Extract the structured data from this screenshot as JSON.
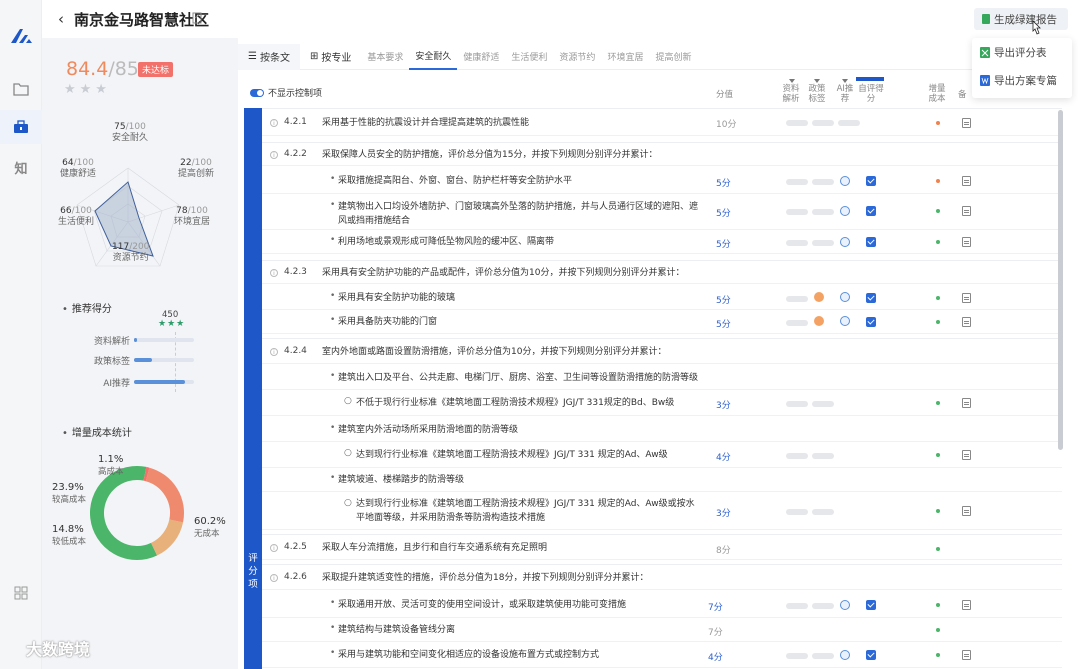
{
  "rail": {
    "knowledge_glyph": "知"
  },
  "header": {
    "title": "南京金马路智慧社区",
    "report_button": "生成绿建报告"
  },
  "dropdown": {
    "items": [
      "导出评分表",
      "导出方案专篇"
    ]
  },
  "summary": {
    "score": "84.4",
    "score_total": "/85",
    "status": "未达标",
    "stars": "★★★",
    "recommend_title": "推荐得分",
    "cost_title": "增量成本统计"
  },
  "radar": [
    {
      "name": "安全耐久",
      "score": "75",
      "max": "/100"
    },
    {
      "name": "提高创新",
      "score": "22",
      "max": "/100"
    },
    {
      "name": "环境宜居",
      "score": "78",
      "max": "/100"
    },
    {
      "name": "资源节约",
      "score": "117",
      "max": "/200"
    },
    {
      "name": "生活便利",
      "score": "66",
      "max": "/100"
    },
    {
      "name": "健康舒适",
      "score": "64",
      "max": "/100"
    }
  ],
  "recommend": {
    "value": "450",
    "stars": "★★★",
    "rows": [
      {
        "label": "资料解析",
        "fraction": 0.05
      },
      {
        "label": "政策标签",
        "fraction": 0.3
      },
      {
        "label": "AI推荐",
        "fraction": 0.85
      }
    ]
  },
  "cost": [
    {
      "name": "高成本",
      "pct": "1.1%",
      "value": 1.1,
      "color": "#f2726b"
    },
    {
      "name": "较高成本",
      "pct": "23.9%",
      "value": 23.9,
      "color": "#f08a6e"
    },
    {
      "name": "较低成本",
      "pct": "14.8%",
      "value": 14.8,
      "color": "#e8b07a"
    },
    {
      "name": "无成本",
      "pct": "60.2%",
      "value": 60.2,
      "color": "#4bb569"
    }
  ],
  "tabs": {
    "view": [
      "按条文",
      "按专业"
    ],
    "cat": [
      "基本要求",
      "安全耐久",
      "健康舒适",
      "生活便利",
      "资源节约",
      "环境宜居",
      "提高创新"
    ]
  },
  "table": {
    "toggle_label": "不显示控制项",
    "cols": [
      "分值",
      "资料解析",
      "政策标签",
      "AI推荐",
      "自评得分",
      "增量成本",
      "备"
    ],
    "band_label": "评分项"
  },
  "rows": [
    {
      "no": "4.2.1",
      "text": "采用基于性能的抗震设计并合理提高建筑的抗震性能",
      "pts": "10分"
    },
    {
      "no": "4.2.2",
      "text": "采取保障人员安全的防护措施，评价总分值为15分，并按下列规则分别评分并累计：",
      "subs": [
        {
          "text": "采取措施提高阳台、外窗、窗台、防护栏杆等安全防护水平",
          "pts": "5分"
        },
        {
          "text": "建筑物出入口均设外墙防护、门窗玻璃高外坠落的防护措施，并与人员通行区域的遮阳、遮风或挡雨措施结合",
          "pts": "5分"
        },
        {
          "text": "利用场地或景观形成可降低坠物风险的缓冲区、隔离带",
          "pts": "5分"
        }
      ]
    },
    {
      "no": "4.2.3",
      "text": "采用具有安全防护功能的产品或配件，评价总分值为10分，并按下列规则分别评分并累计：",
      "subs": [
        {
          "text": "采用具有安全防护功能的玻璃",
          "pts": "5分"
        },
        {
          "text": "采用具备防夹功能的门窗",
          "pts": "5分"
        }
      ]
    },
    {
      "no": "4.2.4",
      "text": "室内外地面或路面设置防滑措施，评价总分值为10分，并按下列规则分别评分并累计：",
      "subs": [
        {
          "text": "建筑出入口及平台、公共走廊、电梯门厅、厨房、浴室、卫生间等设置防滑措施的防滑等级",
          "items": [
            {
              "text": "不低于现行行业标准《建筑地面工程防滑技术规程》JGJ/T 331规定的Bd、Bw级",
              "pts": "3分"
            }
          ]
        },
        {
          "text": "建筑室内外活动场所采用防滑地面的防滑等级",
          "items": [
            {
              "text": "达到现行行业标准《建筑地面工程防滑技术规程》JGJ/T 331 规定的Ad、Aw级",
              "pts": "4分"
            }
          ]
        },
        {
          "text": "建筑坡道、楼梯踏步的防滑等级",
          "items": [
            {
              "text": "达到现行行业标准《建筑地面工程防滑技术规程》JGJ/T 331 规定的Ad、Aw级或按水平地面等级，并采用防滑条等防滑构造技术措施",
              "pts": "3分"
            }
          ]
        }
      ]
    },
    {
      "no": "4.2.5",
      "text": "采取人车分流措施，且步行和自行车交通系统有充足照明",
      "pts": "8分"
    },
    {
      "no": "4.2.6",
      "text": "采取提升建筑适变性的措施，评价总分值为18分，并按下列规则分别评分并累计：",
      "subs": [
        {
          "text": "采取通用开放、灵活可变的使用空间设计，或采取建筑使用功能可变措施",
          "pts": "7分"
        },
        {
          "text": "建筑结构与建筑设备管线分离",
          "pts": "7分"
        },
        {
          "text": "采用与建筑功能和空间变化相适应的设备设施布置方式或控制方式",
          "pts": "4分"
        }
      ]
    }
  ],
  "watermark": "大数跨境"
}
